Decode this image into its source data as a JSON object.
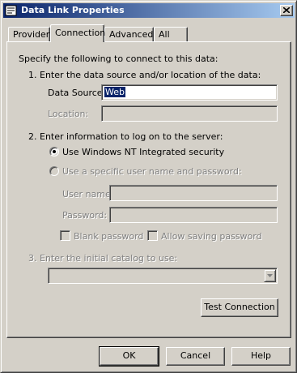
{
  "window": {
    "title": "Data Link Properties",
    "icon": "data-link-icon"
  },
  "tabs": [
    {
      "label": "Provider",
      "active": false
    },
    {
      "label": "Connection",
      "active": true
    },
    {
      "label": "Advanced",
      "active": false
    },
    {
      "label": "All",
      "active": false
    }
  ],
  "connection": {
    "intro": "Specify the following to connect to this data:",
    "step1": "1. Enter the data source and/or location of the data:",
    "data_source_label": "Data Source:",
    "data_source_value": "Web",
    "location_label": "Location:",
    "location_value": "",
    "step2": "2. Enter information to log on to the server:",
    "radio_nt_label": "Use Windows NT Integrated security",
    "radio_specific_label": "Use a specific user name and password:",
    "username_label": "User name:",
    "username_value": "",
    "password_label": "Password:",
    "password_value": "",
    "blank_password_label": "Blank password",
    "allow_saving_label": "Allow saving password",
    "step3": "3. Enter the initial catalog to use:",
    "catalog_value": "",
    "test_connection_label": "Test Connection"
  },
  "footer": {
    "ok_label": "OK",
    "cancel_label": "Cancel",
    "help_label": "Help"
  }
}
